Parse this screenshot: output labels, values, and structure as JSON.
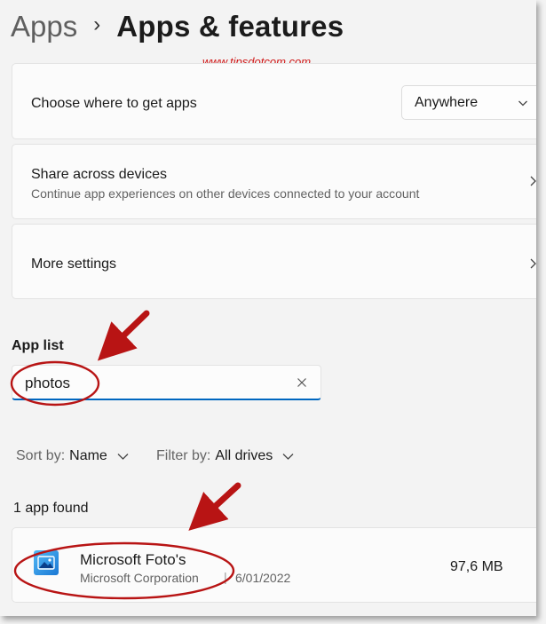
{
  "breadcrumb": {
    "parent": "Apps",
    "separator": "›",
    "current": "Apps & features"
  },
  "watermark": "www.tipsdotcom.com",
  "settings": {
    "get_apps": {
      "label": "Choose where to get apps",
      "selected": "Anywhere"
    },
    "share": {
      "label": "Share across devices",
      "description": "Continue app experiences on other devices connected to your account"
    },
    "more": {
      "label": "More settings"
    }
  },
  "app_list": {
    "title": "App list",
    "search_value": "photos",
    "sort": {
      "label": "Sort by:",
      "value": "Name"
    },
    "filter": {
      "label": "Filter by:",
      "value": "All drives"
    },
    "count": "1 app found",
    "apps": [
      {
        "name": "Microsoft Foto's",
        "publisher": "Microsoft Corporation",
        "separator": "|",
        "date": "6/01/2022",
        "size": "97,6 MB"
      }
    ]
  },
  "annotation_color": "#b81414",
  "accent_color": "#0067c0",
  "icons": [
    "chevron-right-icon",
    "chevron-down-icon",
    "close-icon",
    "photos-app-icon"
  ]
}
